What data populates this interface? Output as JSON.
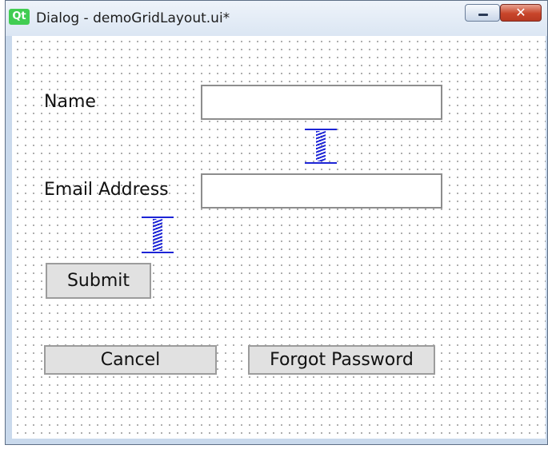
{
  "window": {
    "app_icon": "qt-logo-icon",
    "app_icon_text": "Qt",
    "title": "Dialog - demoGridLayout.ui*",
    "close_glyph": "✕"
  },
  "form": {
    "name_label": "Name",
    "name_value": "",
    "email_label": "Email Address",
    "email_value": "",
    "submit_label": "Submit",
    "cancel_label": "Cancel",
    "forgot_label": "Forgot Password"
  },
  "colors": {
    "spacer": "#1c24d6",
    "qt_green": "#41cd52",
    "close_red": "#c8452a"
  }
}
